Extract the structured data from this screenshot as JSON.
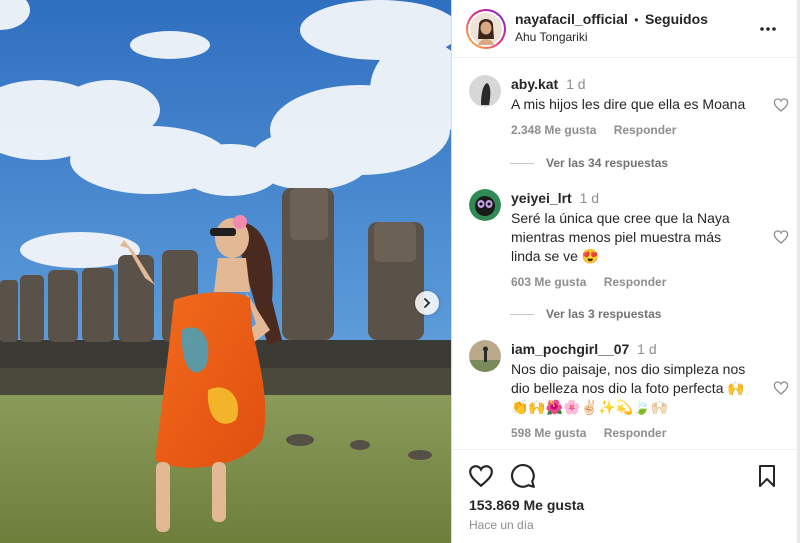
{
  "post": {
    "username": "nayafacil_official",
    "separator": "•",
    "follow_status": "Seguidos",
    "location": "Ahu Tongariki",
    "likes": "153.869 Me gusta",
    "date": "Hace un día"
  },
  "comments": [
    {
      "username": "aby.kat",
      "time": "1 d",
      "text": "A mis hijos les dire que ella es Moana",
      "likes": "2.348 Me gusta",
      "reply_label": "Responder",
      "replies_label": "Ver las 34 respuestas"
    },
    {
      "username": "yeiyei_lrt",
      "time": "1 d",
      "text": "Seré la única que cree que la Naya mientras menos piel muestra más linda se ve 😍",
      "likes": "603 Me gusta",
      "reply_label": "Responder",
      "replies_label": "Ver las 3 respuestas"
    },
    {
      "username": "iam_pochgirl__07",
      "time": "1 d",
      "text": "Nos dio paisaje, nos dio simpleza nos dio belleza nos dio la foto perfecta 🙌 👏🙌🌺🌸✌🏻✨💫🍃🙌🏻",
      "likes": "598 Me gusta",
      "reply_label": "Responder"
    }
  ],
  "icons": {
    "more": "more-horizontal-icon",
    "like": "heart-icon",
    "comment": "comment-icon",
    "save": "bookmark-icon",
    "next": "chevron-right-icon"
  }
}
